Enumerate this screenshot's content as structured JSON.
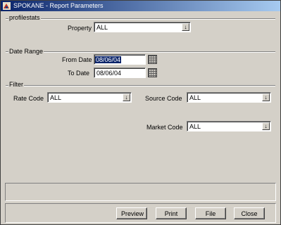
{
  "window": {
    "title": "SPOKANE - Report Parameters"
  },
  "sections": {
    "profilestats": "profilestats",
    "date_range": "Date Range",
    "filter": "Filter"
  },
  "property": {
    "label": "Property",
    "value": "ALL"
  },
  "from_date": {
    "label": "From Date",
    "value": "08/06/04"
  },
  "to_date": {
    "label": "To Date",
    "value": "08/06/04"
  },
  "rate_code": {
    "label": "Rate Code",
    "value": "ALL"
  },
  "source_code": {
    "label": "Source Code",
    "value": "ALL"
  },
  "market_code": {
    "label": "Market Code",
    "value": "ALL"
  },
  "buttons": {
    "preview": "Preview",
    "print": "Print",
    "file": "File",
    "close": "Close"
  },
  "icons": {
    "dropdown": "↓",
    "close": "×"
  }
}
